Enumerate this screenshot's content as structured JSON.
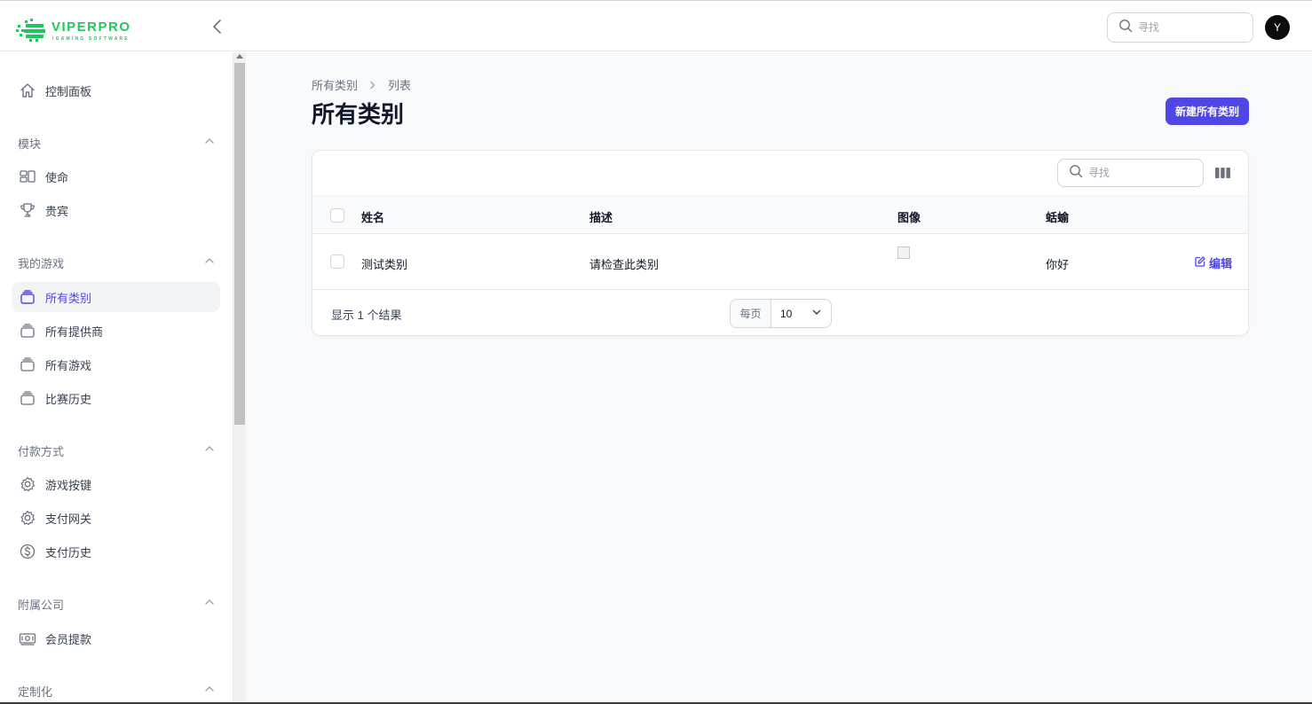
{
  "app": {
    "logo_text": "VIPERPRO",
    "logo_subtext": "IGAMING SOFTWARE",
    "logo_color": "#22c55e",
    "avatar_initial": "Y"
  },
  "header": {
    "search_placeholder": "寻找"
  },
  "sidebar": {
    "items": [
      {
        "label": "控制面板",
        "icon": "home-icon"
      },
      {
        "label": "使命",
        "icon": "layout-icon"
      },
      {
        "label": "贵宾",
        "icon": "trophy-icon"
      },
      {
        "label": "所有类别",
        "icon": "stack-icon",
        "active": true
      },
      {
        "label": "所有提供商",
        "icon": "stack-icon"
      },
      {
        "label": "所有游戏",
        "icon": "stack-icon"
      },
      {
        "label": "比赛历史",
        "icon": "stack-icon"
      },
      {
        "label": "游戏按键",
        "icon": "gear-icon"
      },
      {
        "label": "支付网关",
        "icon": "gear-icon"
      },
      {
        "label": "支付历史",
        "icon": "dollar-icon"
      },
      {
        "label": "会员提款",
        "icon": "cash-icon"
      }
    ],
    "groups": [
      {
        "label": "模块"
      },
      {
        "label": "我的游戏"
      },
      {
        "label": "付款方式"
      },
      {
        "label": "附属公司"
      },
      {
        "label": "定制化"
      }
    ]
  },
  "main": {
    "breadcrumb": [
      "所有类别",
      "列表"
    ],
    "title": "所有类别",
    "new_button_label": "新建所有类别",
    "accent_color": "#4f46e5"
  },
  "table": {
    "search_placeholder": "寻找",
    "columns": [
      "姓名",
      "描述",
      "图像",
      "蛞蝓"
    ],
    "rows": [
      {
        "name": "测试类别",
        "description": "请检查此类别",
        "slug": "你好",
        "action": "编辑"
      }
    ],
    "footer_text": "显示 1 个结果",
    "per_page_label": "每页",
    "per_page_value": "10"
  }
}
